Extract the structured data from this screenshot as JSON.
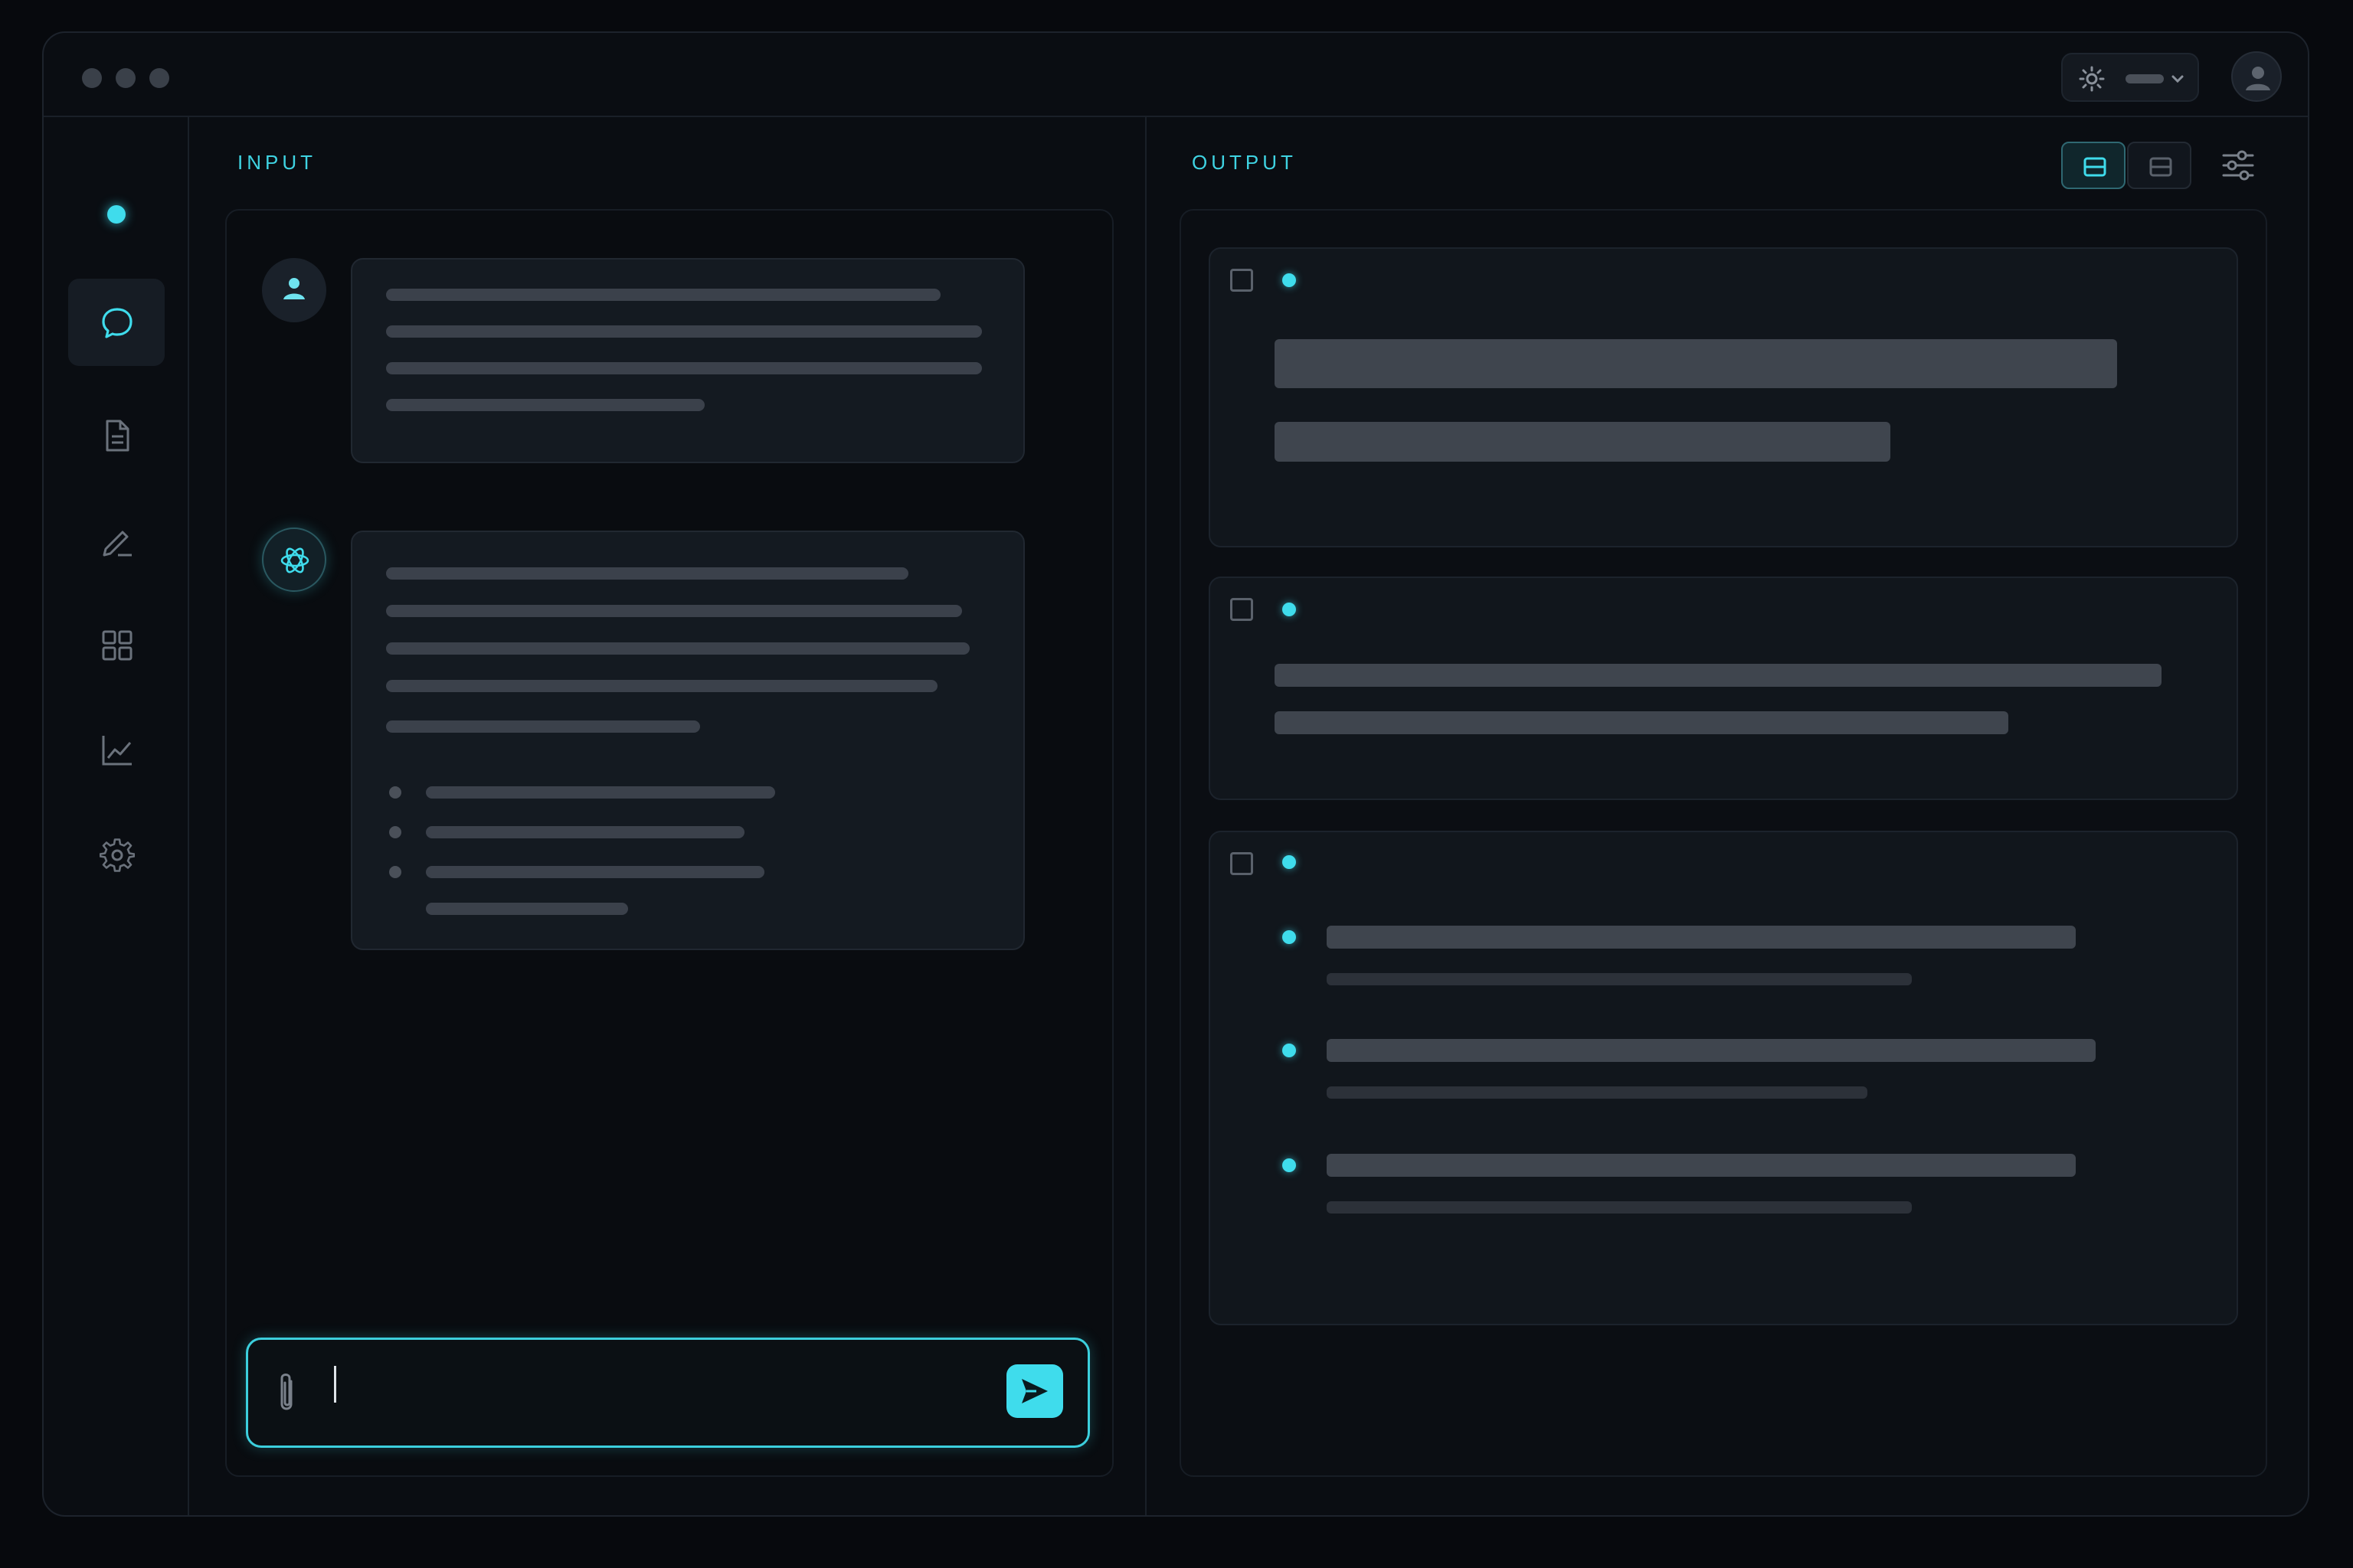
{
  "window": {
    "controls": [
      "close",
      "minimize",
      "maximize"
    ]
  },
  "topbar": {
    "theme_icon": "sun-icon",
    "user_icon": "user-icon"
  },
  "sidebar": {
    "items": [
      {
        "name": "chat",
        "icon": "chat-bubble-icon",
        "active": true
      },
      {
        "name": "documents",
        "icon": "document-icon",
        "active": false
      },
      {
        "name": "edit",
        "icon": "pencil-icon",
        "active": false
      },
      {
        "name": "apps",
        "icon": "grid-icon",
        "active": false
      },
      {
        "name": "analytics",
        "icon": "chart-icon",
        "active": false
      },
      {
        "name": "settings",
        "icon": "gear-icon",
        "active": false
      }
    ]
  },
  "input_pane": {
    "label": "INPUT"
  },
  "output_pane": {
    "label": "OUTPUT",
    "view_modes": [
      "split-view",
      "stacked-view"
    ],
    "active_view": "split-view"
  },
  "composer": {
    "value": "",
    "attach_icon": "paperclip-icon",
    "send_icon": "send-icon"
  },
  "colors": {
    "accent": "#3fdcec",
    "background": "#0a0d12",
    "surface": "#141a21",
    "placeholder": "#3b414b"
  }
}
